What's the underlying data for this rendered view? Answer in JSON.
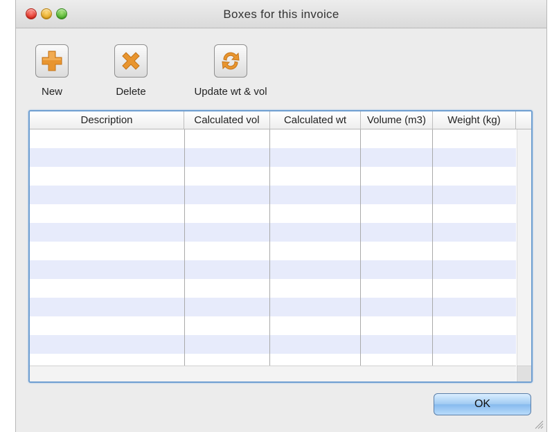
{
  "window": {
    "title": "Boxes for this invoice"
  },
  "toolbar": {
    "new_label": "New",
    "delete_label": "Delete",
    "update_label": "Update wt & vol"
  },
  "table": {
    "columns": [
      "Description",
      "Calculated vol",
      "Calculated wt",
      "Volume (m3)",
      "Weight (kg)"
    ],
    "rows": []
  },
  "footer": {
    "ok_label": "OK"
  },
  "colors": {
    "row_alt": "#e7ebfb",
    "focus_ring": "#6f9fd1",
    "icon_orange": "#e8952f"
  },
  "icons": {
    "new": "plus-icon",
    "delete": "x-icon",
    "update": "refresh-icon"
  }
}
